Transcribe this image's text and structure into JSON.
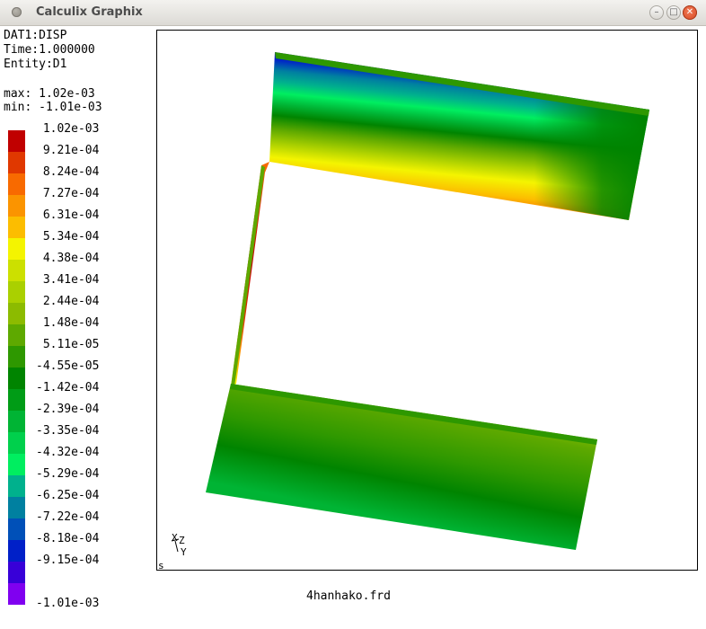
{
  "window": {
    "title": "Calculix Graphix",
    "buttons": {
      "minimize": "–",
      "maximize": "□",
      "close": "✕"
    }
  },
  "info": {
    "dataset": "DAT1:DISP",
    "time": "Time:1.000000",
    "entity": "Entity:D1",
    "max": "max: 1.02e-03",
    "min": "min: -1.01e-03"
  },
  "legend": [
    {
      "label": " 1.02e-03",
      "color": "#c00000"
    },
    {
      "label": " 9.21e-04",
      "color": "#e03800"
    },
    {
      "label": " 8.24e-04",
      "color": "#f86a00"
    },
    {
      "label": " 7.27e-04",
      "color": "#fb9400"
    },
    {
      "label": " 6.31e-04",
      "color": "#fcbd00"
    },
    {
      "label": " 5.34e-04",
      "color": "#f4f400"
    },
    {
      "label": " 4.38e-04",
      "color": "#cce000"
    },
    {
      "label": " 3.41e-04",
      "color": "#aad000"
    },
    {
      "label": " 2.44e-04",
      "color": "#8cbb00"
    },
    {
      "label": " 1.48e-04",
      "color": "#5ea900"
    },
    {
      "label": " 5.11e-05",
      "color": "#2e9800"
    },
    {
      "label": "-4.55e-05",
      "color": "#008400"
    },
    {
      "label": "-1.42e-04",
      "color": "#009c16"
    },
    {
      "label": "-2.39e-04",
      "color": "#00b434"
    },
    {
      "label": "-3.35e-04",
      "color": "#00d04c"
    },
    {
      "label": "-4.32e-04",
      "color": "#00ee60"
    },
    {
      "label": "-5.29e-04",
      "color": "#00b18d"
    },
    {
      "label": "-6.25e-04",
      "color": "#0080a0"
    },
    {
      "label": "-7.22e-04",
      "color": "#0050b8"
    },
    {
      "label": "-8.18e-04",
      "color": "#0020c8"
    },
    {
      "label": "-9.15e-04",
      "color": "#3800d8"
    },
    {
      "label": "-1.01e-03",
      "color": "#8000f0"
    }
  ],
  "axis_triad": {
    "x": "X",
    "y": "Y",
    "z": "Z"
  },
  "corner_mark": "s",
  "filename": "4hanhako.frd"
}
